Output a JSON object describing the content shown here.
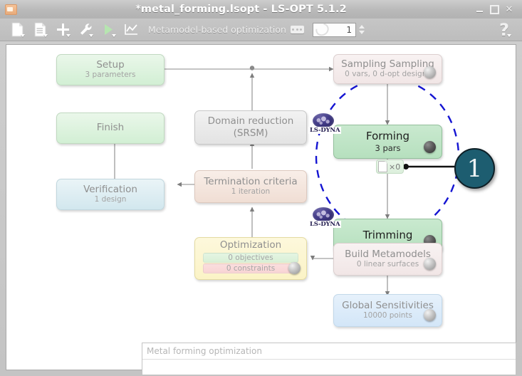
{
  "window": {
    "title": "*metal_forming.lsopt - LS-OPT 5.1.2",
    "icon": "app-icon",
    "minimize": "–",
    "maximize": "□",
    "close": "✕"
  },
  "toolbar": {
    "buttons": [
      {
        "name": "new-file-icon",
        "glyph": "page"
      },
      {
        "name": "open-file-icon",
        "glyph": "page-lines"
      },
      {
        "name": "add-icon",
        "glyph": "plus"
      },
      {
        "name": "tools-icon",
        "glyph": "wrench"
      },
      {
        "name": "run-icon",
        "glyph": "play"
      },
      {
        "name": "plot-icon",
        "glyph": "chart"
      }
    ],
    "task_label": "Metamodel-based optimization",
    "task_options_icon": "ellipsis-icon",
    "iteration_icon": "repeat-icon",
    "iteration_value": "1",
    "spinner_up": "▲",
    "spinner_down": "▼",
    "help_label": "?"
  },
  "flow": {
    "nodes": [
      {
        "id": "setup",
        "title": "Setup",
        "sub": "3 parameters",
        "orb": false,
        "solver": null
      },
      {
        "id": "sampling",
        "title": "Sampling Sampling",
        "sub": "0 vars, 0 d-opt designs",
        "orb": true,
        "solver": null
      },
      {
        "id": "finish",
        "title": "Finish",
        "sub": "",
        "orb": false,
        "solver": null
      },
      {
        "id": "domain",
        "title": "Domain reduction",
        "sub": "(SRSM)",
        "orb": false,
        "solver": null
      },
      {
        "id": "forming",
        "title": "Forming",
        "sub": "3 pars",
        "orb": true,
        "solver": "LS-DYNA"
      },
      {
        "id": "verification",
        "title": "Verification",
        "sub": "1 design",
        "orb": false,
        "solver": null
      },
      {
        "id": "termination",
        "title": "Termination criteria",
        "sub": "1 iteration",
        "orb": false,
        "solver": null
      },
      {
        "id": "trimming",
        "title": "Trimming",
        "sub": "",
        "orb": true,
        "solver": "LS-DYNA"
      },
      {
        "id": "optimization",
        "title": "Optimization",
        "sub": "",
        "orb": true,
        "solver": null
      },
      {
        "id": "metamodels",
        "title": "Build Metamodels",
        "sub": "0 linear surfaces",
        "orb": true,
        "solver": null
      },
      {
        "id": "sensitivities",
        "title": "Global Sensitivities",
        "sub": "10000 points",
        "orb": true,
        "solver": null
      }
    ],
    "optimization_objectives": "0 objectives",
    "optimization_constraints": "0 constraints",
    "file_transfer_count": "×0",
    "file_transfer_icon": "file-icon",
    "callout_number": "1",
    "selection_ellipse": "dashed-selection-ellipse"
  },
  "notes": {
    "text": "Metal forming optimization"
  },
  "colors": {
    "callout_fill": "#1d5d70",
    "selection_dash": "#1414d2",
    "active_node_fill": "#bce2c4",
    "accent_text": "#8f8f8f"
  }
}
